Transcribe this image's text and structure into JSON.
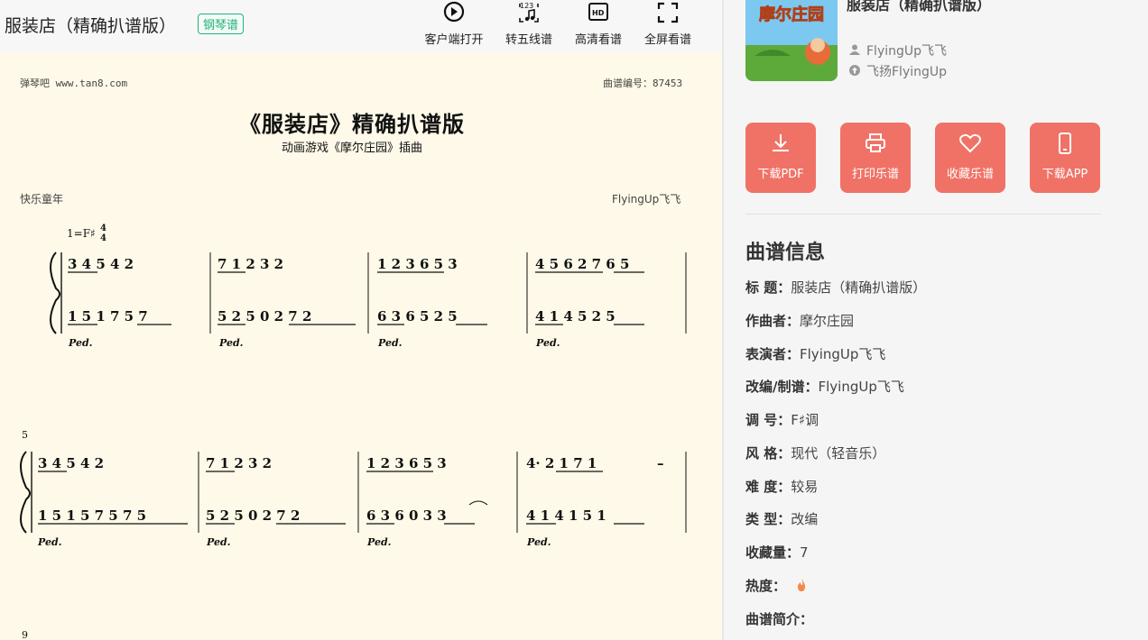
{
  "header": {
    "title": "服装店（精确扒谱版）",
    "badge": "钢琴谱",
    "tools": [
      {
        "icon": "play-circle-icon",
        "label": "客户端打开"
      },
      {
        "icon": "numbered-notation-icon",
        "label": "转五线谱"
      },
      {
        "icon": "hd-icon",
        "label": "高清看谱"
      },
      {
        "icon": "fullscreen-icon",
        "label": "全屏看谱"
      }
    ]
  },
  "sheet": {
    "site": "弹琴吧 www.tan8.com",
    "number": "曲谱编号：87453",
    "title": "《服装店》精确扒谱版",
    "subtitle": "动画游戏《摩尔庄园》插曲",
    "style_label": "快乐童年",
    "arranger": "FlyingUp飞飞",
    "key_time": "1=F♯",
    "time_sig": [
      "4",
      "4"
    ],
    "measure_5": "5",
    "measure_9": "9",
    "pedal": "Ped.",
    "dash": "–",
    "rows": [
      {
        "treble": [
          "3 4 5 4 2",
          "7 1 2 3 2",
          "1 2 3 6 5 3",
          "4 5 6 2 7 6 5"
        ],
        "bass": [
          "1 5 1 7 5 7",
          "5 2 5 0 2 7 2",
          "6 3 6 5 2 5",
          "4 1 4 5 2 5"
        ]
      },
      {
        "treble": [
          "3 4 5 4 2",
          "7 1 2 3 2",
          "1 2 3 6 5 3",
          "4· 2 1 7 1"
        ],
        "bass": [
          "1 5 1 5 7 5 7 5",
          "5 2 5 0 2 7 2",
          "6 3 6 0 3 3",
          "4 1 4 1 5 1"
        ]
      }
    ]
  },
  "sidebar": {
    "song_title": "服装店（精确扒谱版）",
    "cover_text": "摩尔庄园",
    "author": "FlyingUp飞飞",
    "uploader": "飞扬FlyingUp",
    "buttons": [
      {
        "icon": "download-icon",
        "label": "下载PDF"
      },
      {
        "icon": "printer-icon",
        "label": "打印乐谱"
      },
      {
        "icon": "heart-icon",
        "label": "收藏乐谱"
      },
      {
        "icon": "phone-icon",
        "label": "下载APP"
      }
    ],
    "info_heading": "曲谱信息",
    "info": [
      {
        "k": "标 题：",
        "v": "服装店（精确扒谱版）"
      },
      {
        "k": "作曲者：",
        "v": "摩尔庄园"
      },
      {
        "k": "表演者：",
        "v": "FlyingUp飞飞"
      },
      {
        "k": "改编/制谱：",
        "v": "FlyingUp飞飞"
      },
      {
        "k": "调 号：",
        "v": "F♯调"
      },
      {
        "k": "风 格：",
        "v": "现代（轻音乐）"
      },
      {
        "k": "难 度：",
        "v": "较易"
      },
      {
        "k": "类 型：",
        "v": "改编"
      },
      {
        "k": "收藏量：",
        "v": "7"
      },
      {
        "k": "热度：",
        "v": ""
      },
      {
        "k": "曲谱简介：",
        "v": ""
      }
    ],
    "accent": "#f07266",
    "badge_color": "#26b07a"
  }
}
